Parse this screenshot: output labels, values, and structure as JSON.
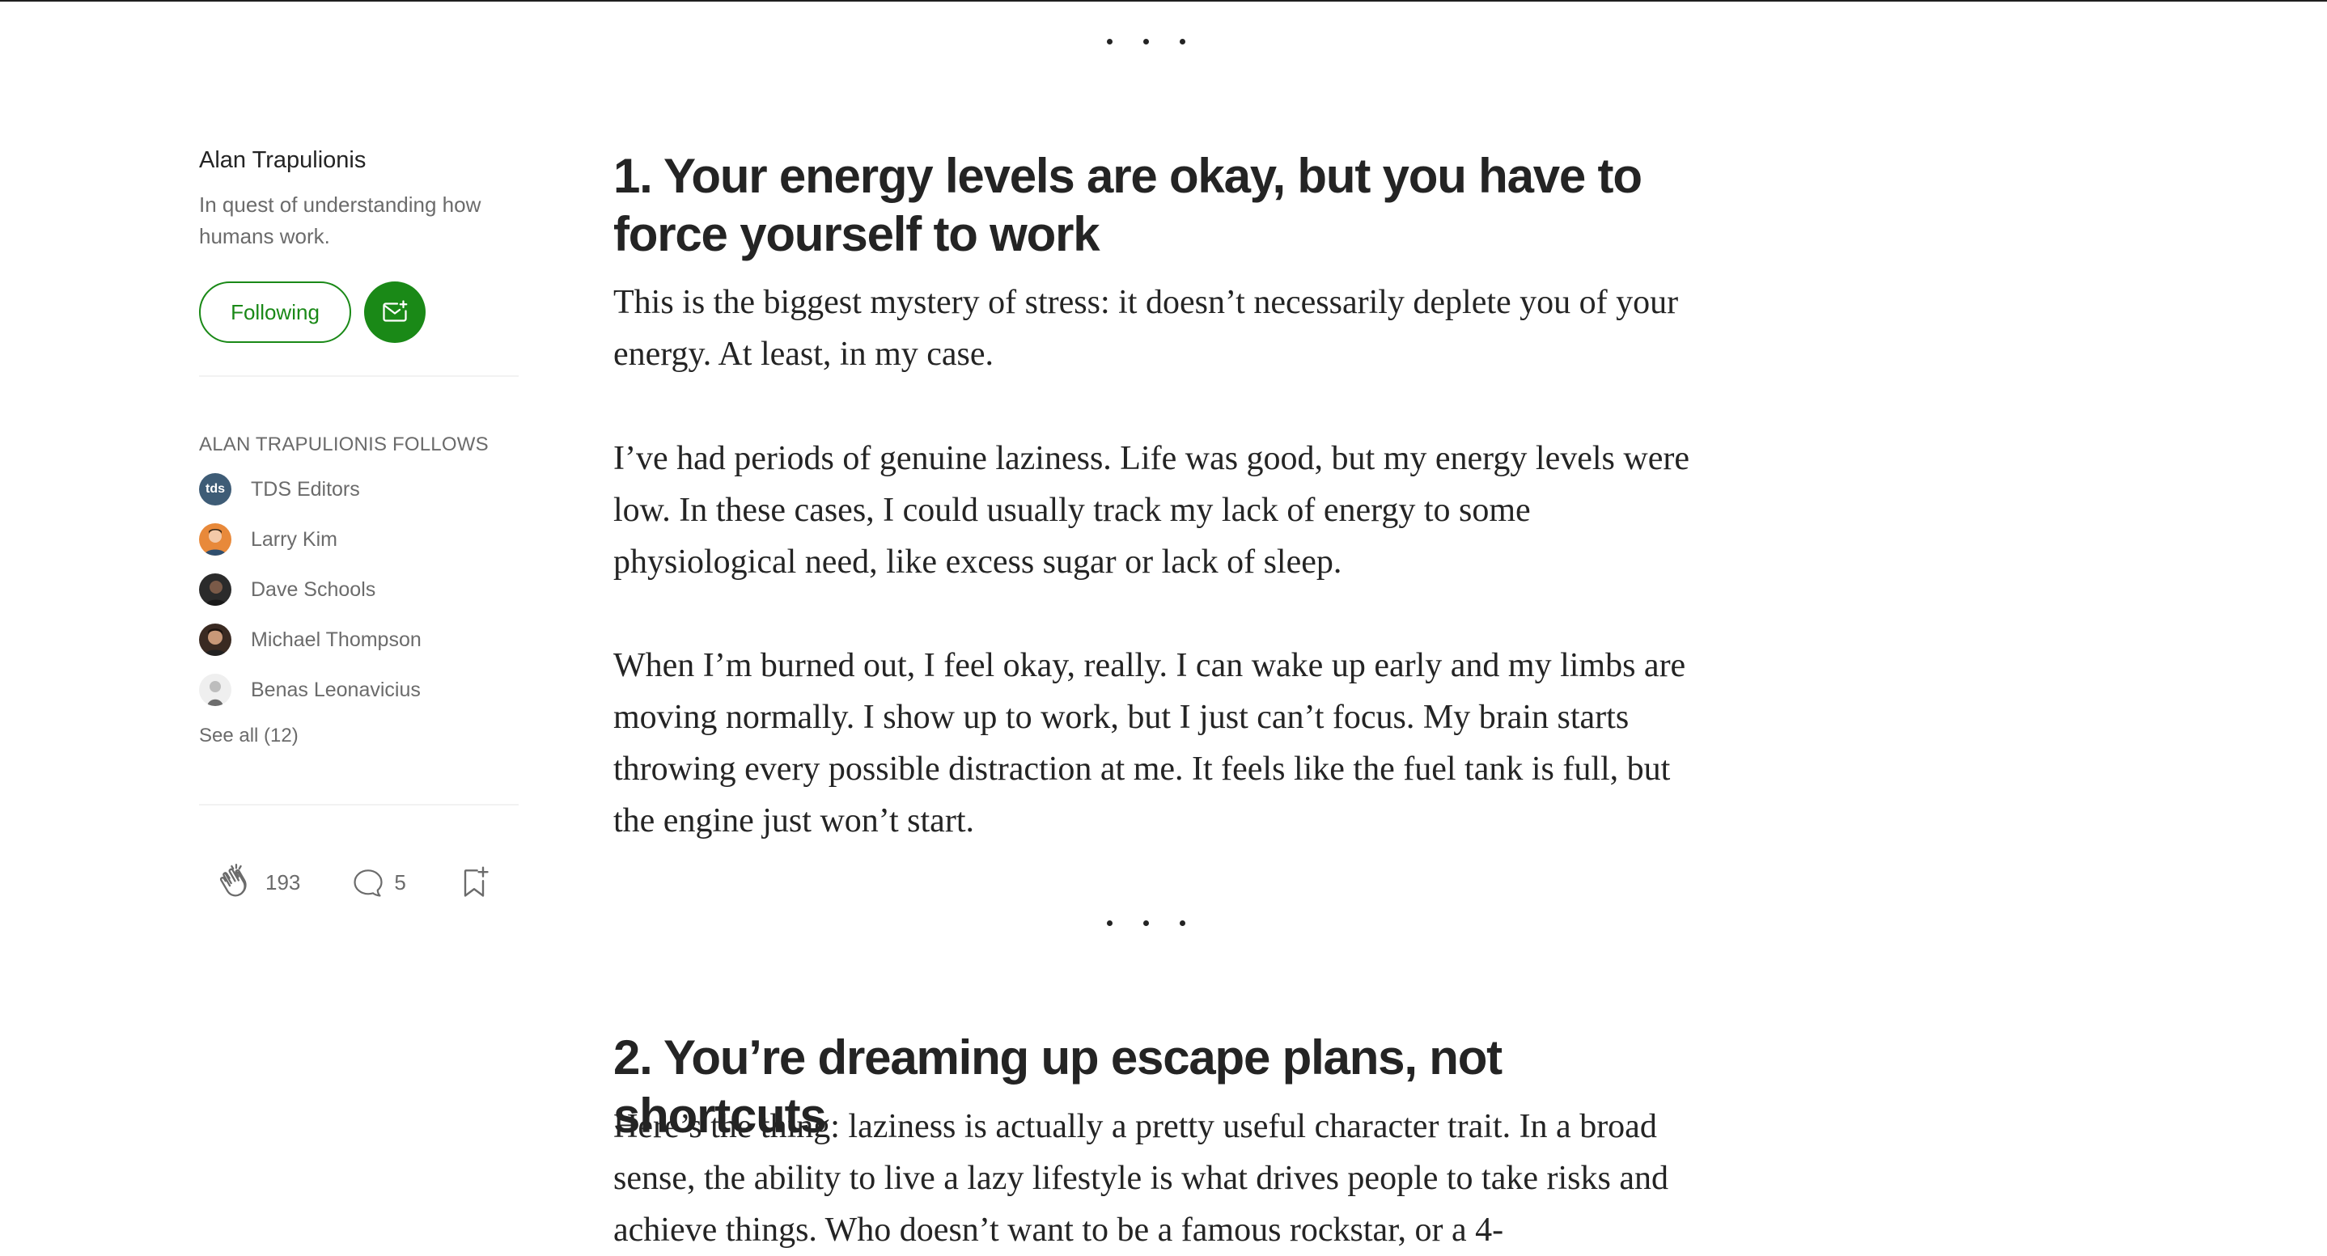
{
  "author": {
    "name": "Alan Trapulionis",
    "bio": "In quest of understanding how humans work.",
    "following_label": "Following"
  },
  "follows": {
    "heading": "ALAN TRAPULIONIS FOLLOWS",
    "items": [
      {
        "name": "TDS Editors",
        "avatar_text": "tds",
        "avatar_color": "#3e5c76"
      },
      {
        "name": "Larry Kim",
        "avatar_color": "#e8893a"
      },
      {
        "name": "Dave Schools",
        "avatar_color": "#2b2b2b"
      },
      {
        "name": "Michael Thompson",
        "avatar_color": "#3a2a22"
      },
      {
        "name": "Benas Leonavicius",
        "avatar_color": "#d9d9d9"
      }
    ],
    "see_all": "See all (12)"
  },
  "engagement": {
    "claps": "193",
    "responses": "5"
  },
  "article": {
    "section1_title": "1. Your energy levels are okay, but you have to force yourself to work",
    "p1": "This is the biggest mystery of stress: it doesn’t necessarily deplete you of your energy. At least, in my case.",
    "p2": "I’ve had periods of genuine laziness. Life was good, but my energy levels were low. In these cases, I could usually track my lack of energy to some physiological need, like excess sugar or lack of sleep.",
    "p3": "When I’m burned out, I feel okay, really. I can wake up early and my limbs are moving normally. I show up to work, but I just can’t focus. My brain starts throwing every possible distraction at me. It feels like the fuel tank is full, but the engine just won’t start.",
    "section2_title": "2. You’re dreaming up escape plans, not shortcuts",
    "p4": "Here’s the thing: laziness is actually a pretty useful character trait. In a broad sense, the ability to live a lazy lifestyle is what drives people to take risks and achieve things. Who doesn’t want to be a famous rockstar, or a 4-"
  },
  "colors": {
    "accent_green": "#1a8917",
    "text": "#242424",
    "muted": "#6b6b6b"
  }
}
